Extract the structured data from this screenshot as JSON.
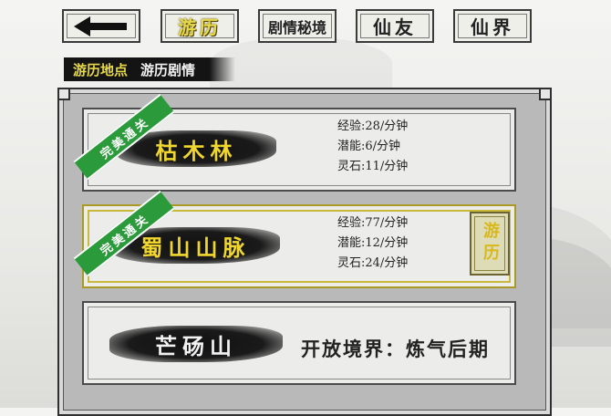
{
  "nav": {
    "back_icon": "left-arrow-icon",
    "tabs": [
      {
        "label": "游历",
        "active": true
      },
      {
        "label": "剧情秘境",
        "active": false
      },
      {
        "label": "仙友",
        "active": false
      },
      {
        "label": "仙界",
        "active": false
      }
    ]
  },
  "subtabs": [
    {
      "label": "游历地点",
      "active": true
    },
    {
      "label": "游历剧情",
      "active": false
    }
  ],
  "locations": [
    {
      "name": "枯木林",
      "badge": "完美通关",
      "stats": [
        "经验:28/分钟",
        "潜能:6/分钟",
        "灵石:11/分钟"
      ]
    },
    {
      "name": "蜀山山脉",
      "badge": "完美通关",
      "stats": [
        "经验:77/分钟",
        "潜能:12/分钟",
        "灵石:24/分钟"
      ],
      "action": "游历"
    },
    {
      "name": "芒砀山",
      "requirement": "开放境界：炼气后期"
    }
  ],
  "colors": {
    "accent_gold": "#e6d84a",
    "badge_green": "#2a9a3a"
  }
}
